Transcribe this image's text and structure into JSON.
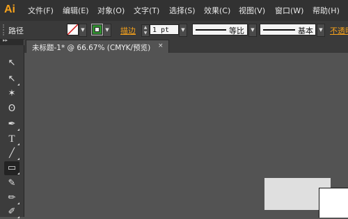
{
  "app": {
    "logo": "Ai"
  },
  "menubar": {
    "items": [
      "文件(F)",
      "编辑(E)",
      "对象(O)",
      "文字(T)",
      "选择(S)",
      "效果(C)",
      "视图(V)",
      "窗口(W)",
      "帮助(H)"
    ]
  },
  "controlbar": {
    "selection_label": "路径",
    "fill_color": "none",
    "stroke_label": "描边",
    "stroke_weight": "1 pt",
    "profile_uniform_label": "等比",
    "brush_basic_label": "基本",
    "opacity_label": "不透明"
  },
  "document": {
    "tab_title": "未标题-1* @ 66.67% (CMYK/预览)",
    "close_glyph": "×"
  },
  "toolbox": {
    "collapse_glyph": "▸▸",
    "tools": [
      {
        "name": "selection-tool-icon",
        "glyph": "↖"
      },
      {
        "name": "direct-selection-tool-icon",
        "glyph": "↖"
      },
      {
        "name": "magic-wand-tool-icon",
        "glyph": "✶"
      },
      {
        "name": "lasso-tool-icon",
        "glyph": "ʘ"
      },
      {
        "name": "pen-tool-icon",
        "glyph": "✒"
      },
      {
        "name": "type-tool-icon",
        "glyph": "T"
      },
      {
        "name": "line-segment-tool-icon",
        "glyph": "╱"
      },
      {
        "name": "rectangle-tool-icon",
        "glyph": "▭"
      },
      {
        "name": "paintbrush-tool-icon",
        "glyph": "✎"
      },
      {
        "name": "pencil-tool-icon",
        "glyph": "✏"
      },
      {
        "name": "blob-brush-tool-icon",
        "glyph": "✐"
      }
    ]
  },
  "colors": {
    "accent": "#f7a21b",
    "canvas": "#535353",
    "chrome": "#323232"
  }
}
